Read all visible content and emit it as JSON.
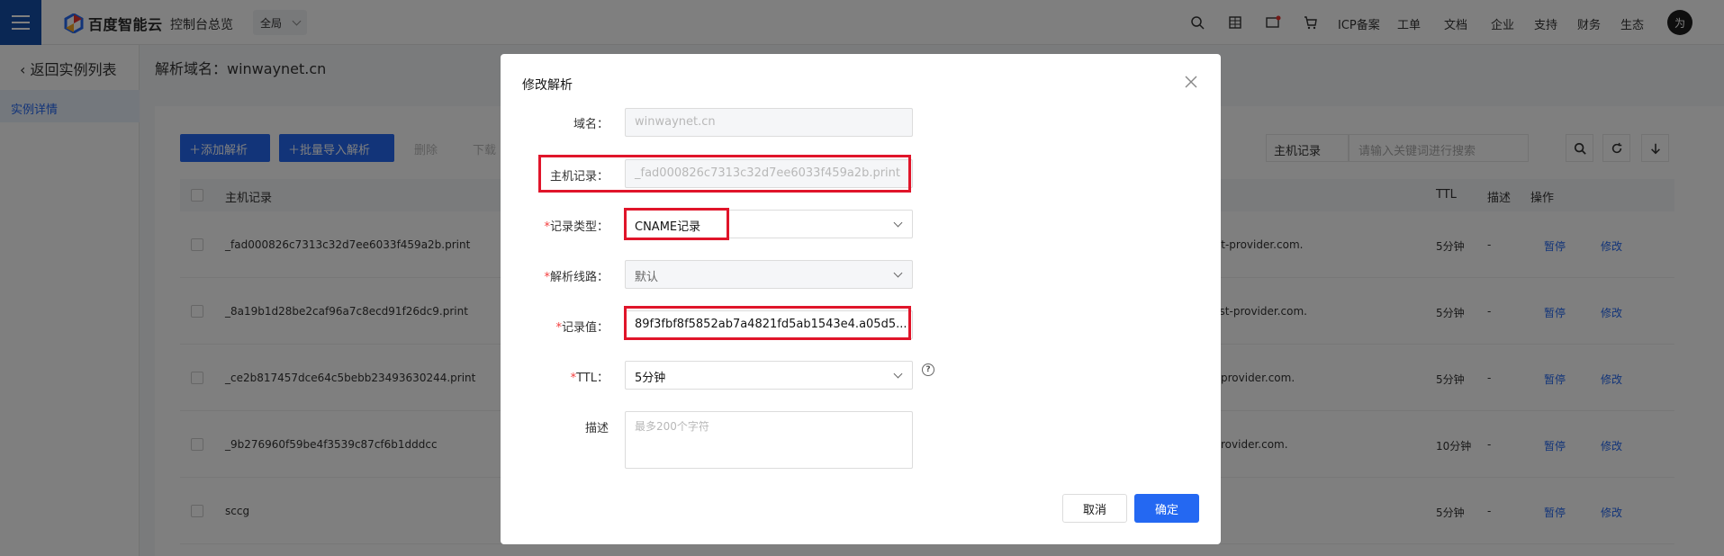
{
  "topbar": {
    "logo_text": "百度智能云",
    "console_link": "控制台总览",
    "region": "全局",
    "nav_links": [
      "ICP备案",
      "工单",
      "文档",
      "企业",
      "支持",
      "财务",
      "生态"
    ],
    "avatar_initial": "为",
    "icons": [
      "search-icon",
      "apps-icon",
      "message-icon",
      "cart-icon"
    ]
  },
  "sidebar": {
    "back_link": "返回实例列表",
    "item": "实例详情"
  },
  "main": {
    "page_title": "解析域名：winwaynet.cn",
    "toolbar": {
      "add": "添加解析",
      "batch_import": "批量导入解析",
      "delete": "删除",
      "download": "下载"
    },
    "search": {
      "select": "主机记录",
      "placeholder": "请输入关键词进行搜索"
    },
    "table": {
      "headers": [
        "主机记录",
        "TTL",
        "描述",
        "操作"
      ],
      "rows": [
        {
          "host": "_fad000826c7313c32d7ee6033f459a2b.print",
          "value": "st-provider.com.",
          "ttl": "5分钟",
          "desc": "-",
          "pause": "暂停",
          "edit": "修改"
        },
        {
          "host": "_8a19b1d28be2caf96a7c8ecd91f26dc9.print",
          "value": "rust-provider.com.",
          "ttl": "5分钟",
          "desc": "-",
          "pause": "暂停",
          "edit": "修改"
        },
        {
          "host": "_ce2b817457dce64c5bebb23493630244.print",
          "value": "provider.com.",
          "ttl": "5分钟",
          "desc": "-",
          "pause": "暂停",
          "edit": "修改"
        },
        {
          "host": "_9b276960f59be4f3539c87cf6b1dddcc",
          "value": "rovider.com.",
          "ttl": "10分钟",
          "desc": "-",
          "pause": "暂停",
          "edit": "修改"
        },
        {
          "host": "sccg",
          "value": "",
          "ttl": "5分钟",
          "desc": "-",
          "pause": "暂停",
          "edit": "修改"
        }
      ]
    }
  },
  "dialog": {
    "title": "修改解析",
    "domain_label": "域名：",
    "domain_value": "winwaynet.cn",
    "host_label": "主机记录：",
    "host_value": "_fad000826c7313c32d7ee6033f459a2b.print",
    "type_label": "记录类型：",
    "type_value": "CNAME记录",
    "line_label": "解析线路：",
    "line_value": "默认",
    "record_label": "记录值：",
    "record_value": "89f3fbf8f5852ab7a4821fd5ab1543e4.a05d5...",
    "ttl_label": "TTL：",
    "ttl_value": "5分钟",
    "desc_label": "描述",
    "desc_placeholder": "最多200个字符",
    "help": "?",
    "required_mark": "*",
    "cancel": "取消",
    "ok": "确定"
  },
  "colors": {
    "primary": "#2468f2",
    "highlight": "#e0152a",
    "overlay": "rgba(0,0,0,0.5)"
  }
}
